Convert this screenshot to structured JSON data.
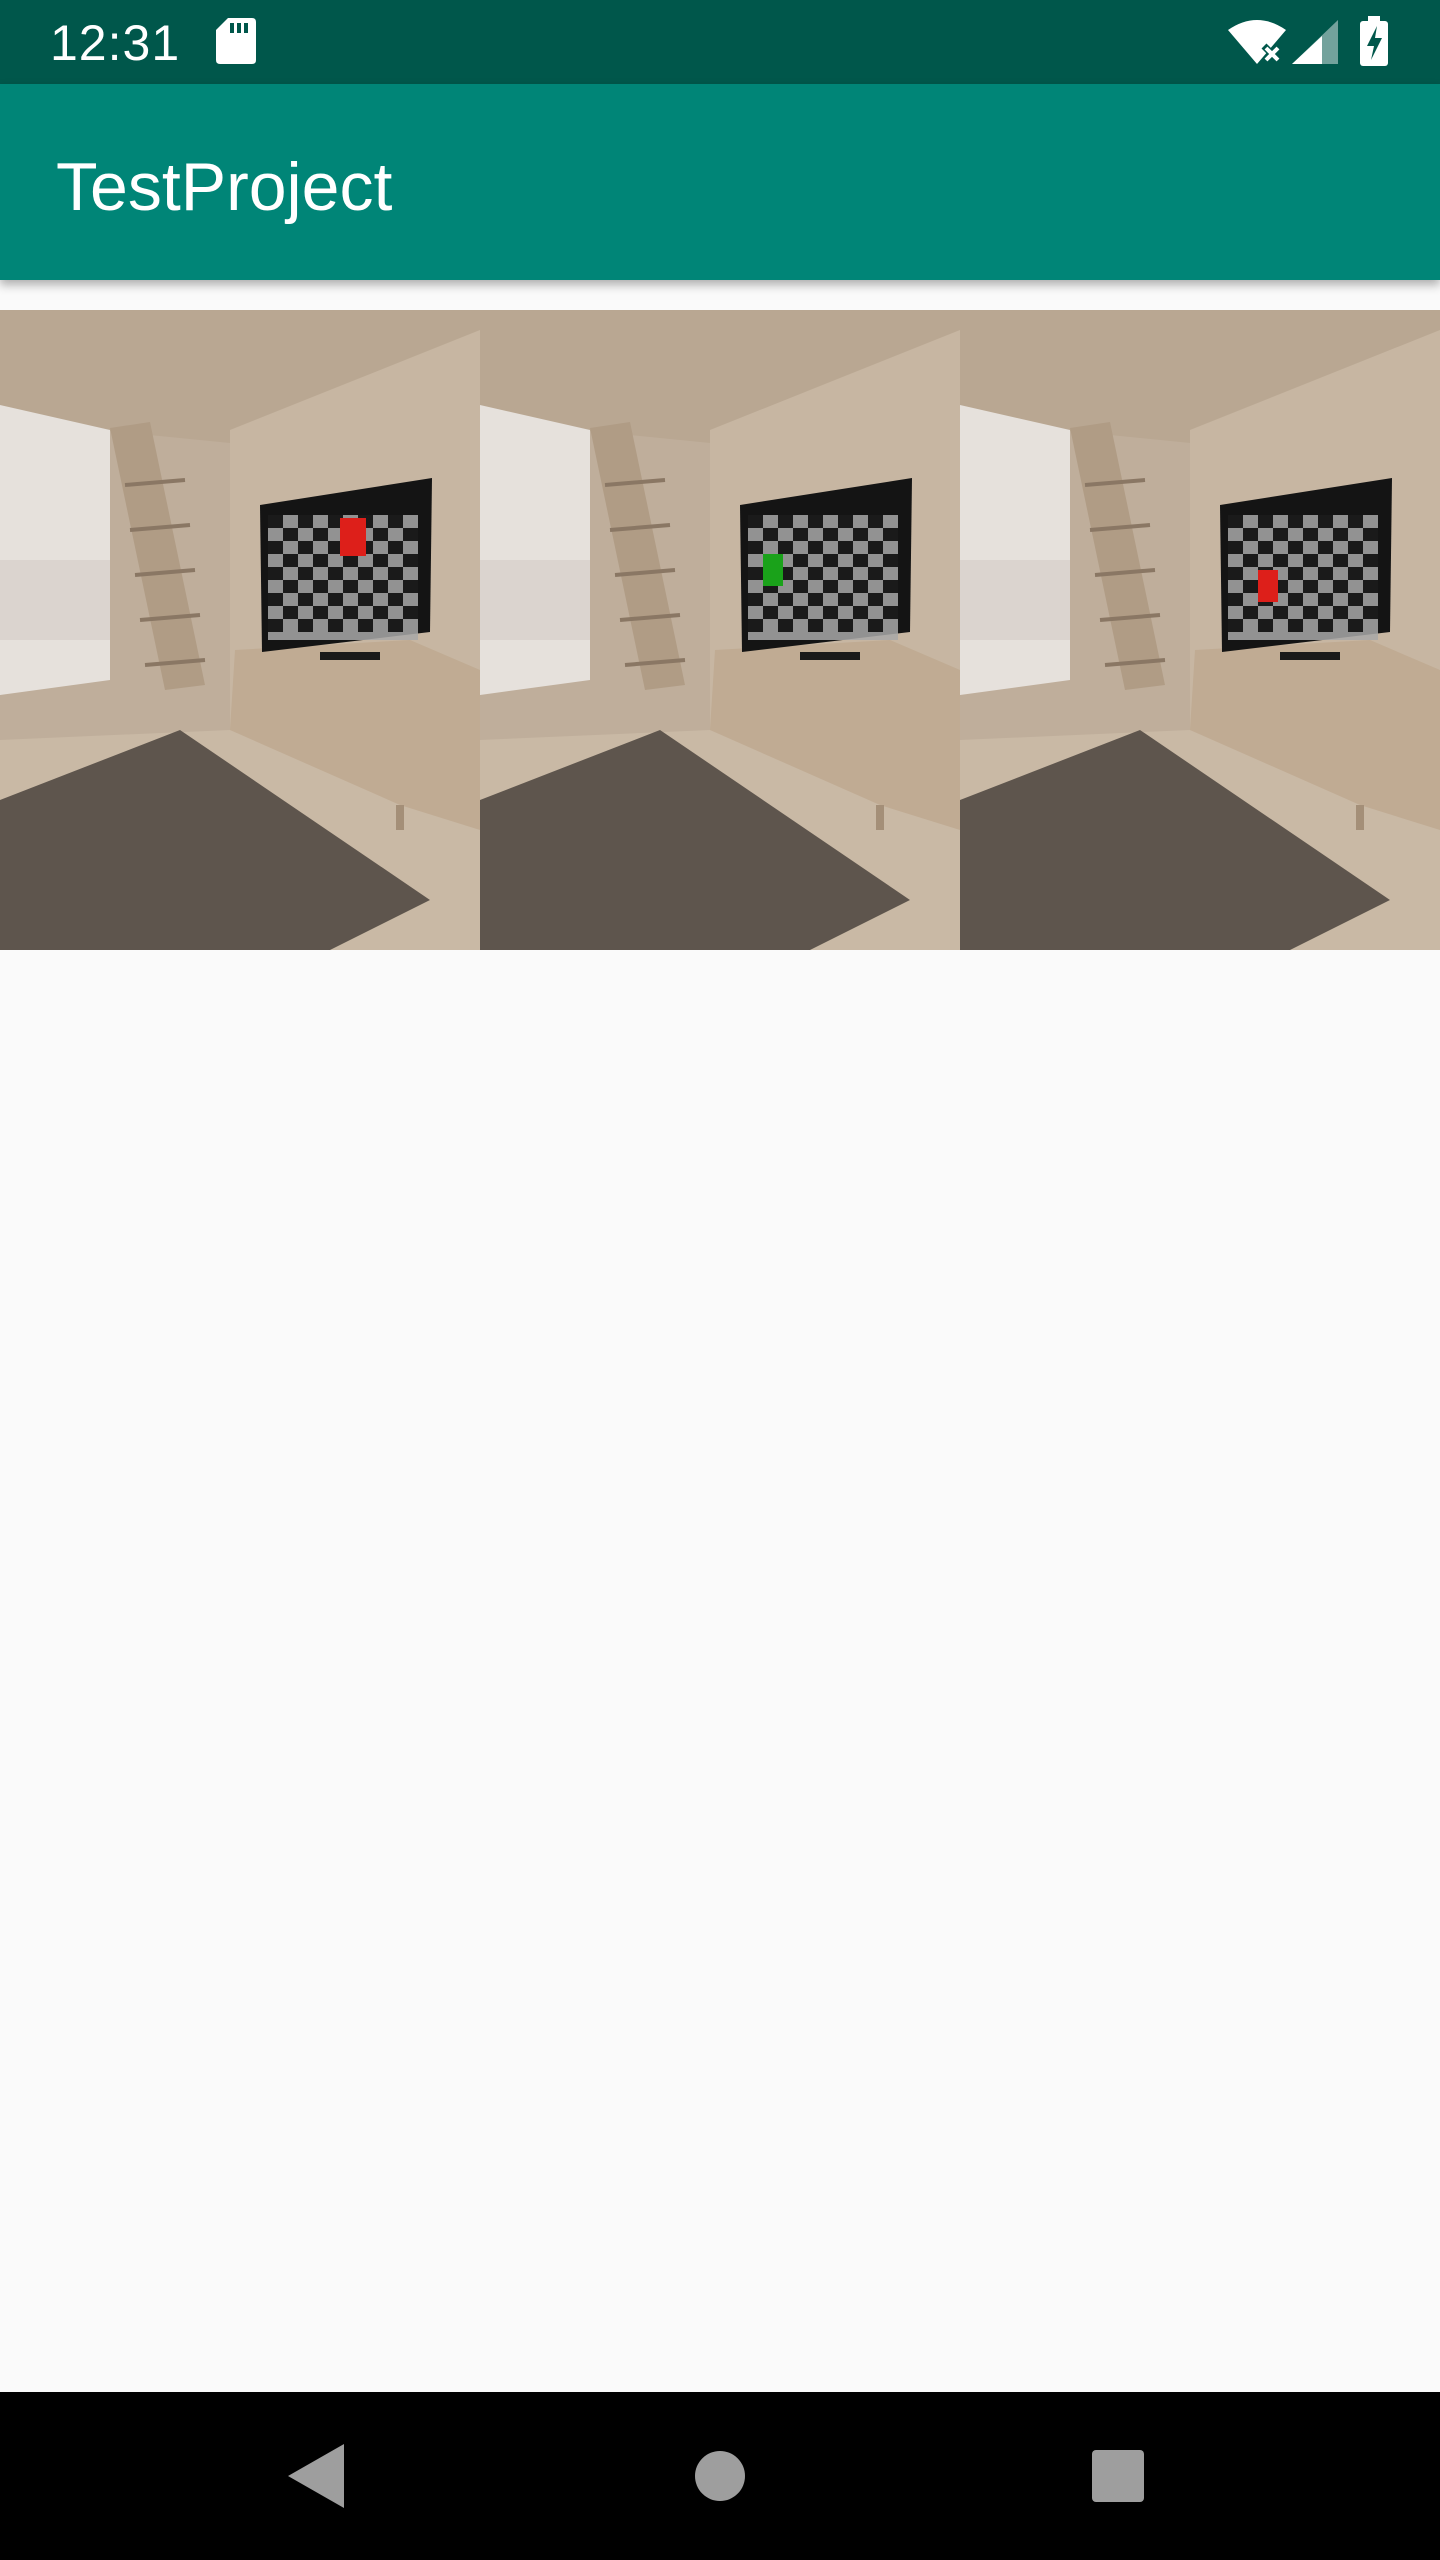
{
  "status_bar": {
    "time": "12:31",
    "icons": [
      "sd-card-icon",
      "wifi-no-internet-icon",
      "cell-signal-icon",
      "battery-charging-icon"
    ]
  },
  "app_bar": {
    "title": "TestProject"
  },
  "gallery": {
    "images": [
      {
        "subject": "living room with checkerboard tv",
        "marker_color": "#dd1f1a"
      },
      {
        "subject": "living room with checkerboard tv",
        "marker_color": "#1aa21a"
      },
      {
        "subject": "living room with checkerboard tv",
        "marker_color": "#dd1f1a"
      }
    ]
  },
  "nav_bar": {
    "buttons": [
      "back-icon",
      "home-icon",
      "recents-icon"
    ]
  },
  "colors": {
    "status_bar": "#00574b",
    "app_bar": "#008577",
    "background": "#fafafa",
    "nav_bar": "#000000"
  }
}
